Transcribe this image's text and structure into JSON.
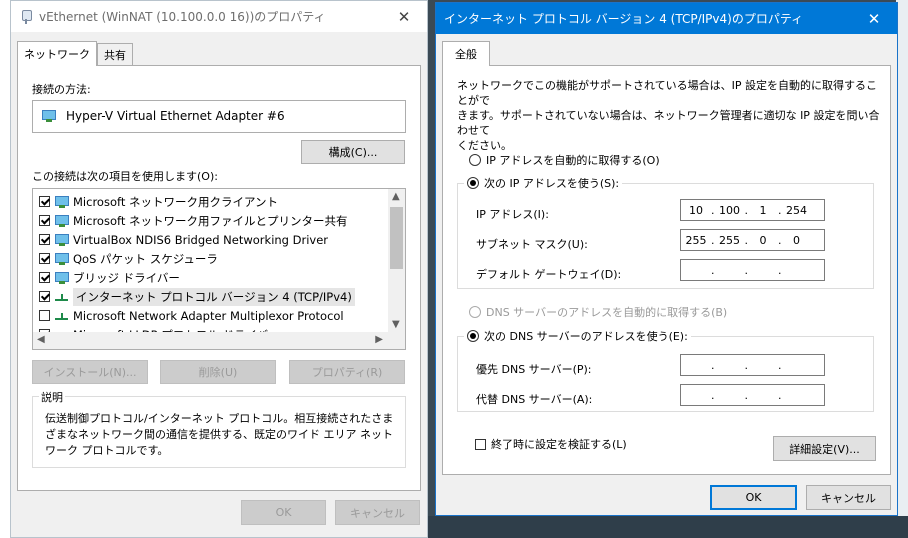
{
  "left_window": {
    "title": "vEthernet (WinNAT (10.100.0.0 16))のプロパティ",
    "tabs": [
      "ネットワーク",
      "共有"
    ],
    "connect_using_label": "接続の方法:",
    "adapter_name": "Hyper-V Virtual Ethernet Adapter #6",
    "configure_button": "構成(C)...",
    "items_label": "この接続は次の項目を使用します(O):",
    "items": [
      {
        "label": "Microsoft ネットワーク用クライアント",
        "checked": true,
        "icon": "network-client-icon"
      },
      {
        "label": "Microsoft ネットワーク用ファイルとプリンター共有",
        "checked": true,
        "icon": "file-share-icon"
      },
      {
        "label": "VirtualBox NDIS6 Bridged Networking Driver",
        "checked": true,
        "icon": "network-driver-icon"
      },
      {
        "label": "QoS パケット スケジューラ",
        "checked": true,
        "icon": "qos-icon"
      },
      {
        "label": "ブリッジ ドライバー",
        "checked": true,
        "icon": "bridge-icon"
      },
      {
        "label": "インターネット プロトコル バージョン 4 (TCP/IPv4)",
        "checked": true,
        "icon": "protocol-icon",
        "selected": true
      },
      {
        "label": "Microsoft Network Adapter Multiplexor Protocol",
        "checked": false,
        "icon": "protocol-icon"
      },
      {
        "label": "Microsoft LLDP プロトコル ドライバー",
        "checked": true,
        "icon": "protocol-icon"
      }
    ],
    "install_button": "インストール(N)...",
    "uninstall_button": "削除(U)",
    "properties_button": "プロパティ(R)",
    "description_title": "説明",
    "description_text": "伝送制御プロトコル/インターネット プロトコル。相互接続されたさまざまなネットワーク間の通信を提供する、既定のワイド エリア ネットワーク プロトコルです。",
    "ok_button": "OK",
    "cancel_button": "キャンセル"
  },
  "right_window": {
    "title": "インターネット プロトコル バージョン 4 (TCP/IPv4)のプロパティ",
    "tab": "全般",
    "intro_text_1": "ネットワークでこの機能がサポートされている場合は、IP 設定を自動的に取得することがで",
    "intro_text_2": "きます。サポートされていない場合は、ネットワーク管理者に適切な IP 設定を問い合わせて",
    "intro_text_3": "ください。",
    "auto_ip_label": "IP アドレスを自動的に取得する(O)",
    "manual_ip_label": "次の IP アドレスを使う(S):",
    "ip_address_label": "IP アドレス(I):",
    "ip_address": [
      "10",
      "100",
      "1",
      "254"
    ],
    "subnet_label": "サブネット マスク(U):",
    "subnet_mask": [
      "255",
      "255",
      "0",
      "0"
    ],
    "gateway_label": "デフォルト ゲートウェイ(D):",
    "gateway": [
      "",
      "",
      "",
      ""
    ],
    "auto_dns_label": "DNS サーバーのアドレスを自動的に取得する(B)",
    "manual_dns_label": "次の DNS サーバーのアドレスを使う(E):",
    "preferred_dns_label": "優先 DNS サーバー(P):",
    "preferred_dns": [
      "",
      "",
      "",
      ""
    ],
    "alternate_dns_label": "代替 DNS サーバー(A):",
    "alternate_dns": [
      "",
      "",
      "",
      ""
    ],
    "validate_label": "終了時に設定を検証する(L)",
    "advanced_button": "詳細設定(V)...",
    "ok_button": "OK",
    "cancel_button": "キャンセル"
  }
}
